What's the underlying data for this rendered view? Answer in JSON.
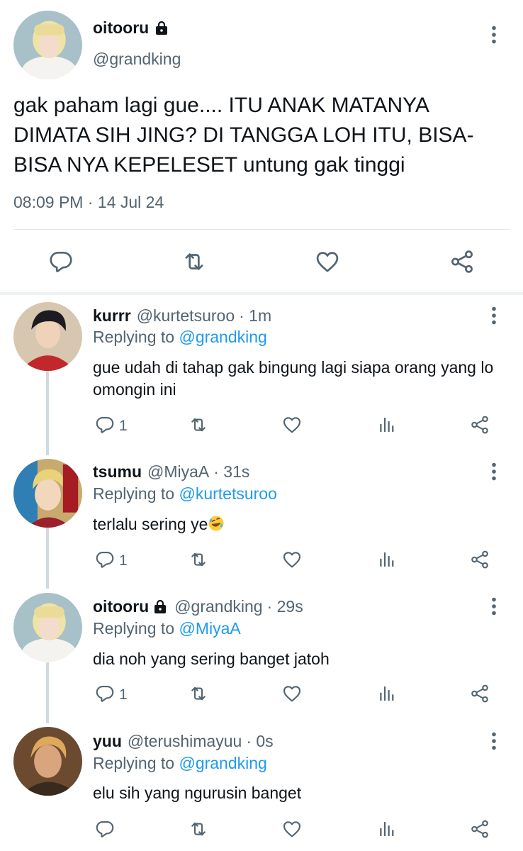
{
  "main_tweet": {
    "display_name": "oitooru",
    "handle": "@grandking",
    "text": "gak paham lagi gue.... ITU ANAK MATANYA DIMATA SIH JING? DI TANGGA LOH ITU, BISA-BISA NYA KEPELESET untung gak tinggi",
    "time": "08:09 PM",
    "separator": "·",
    "date": "14 Jul 24",
    "icons": {
      "reply": "reply-icon",
      "retweet": "retweet-icon",
      "like": "heart-icon",
      "share": "share-icon",
      "more": "more-icon",
      "lock": "lock-icon"
    }
  },
  "replies": [
    {
      "display_name": "kurrr",
      "handle": "@kurtetsuroo",
      "time": "· 1m",
      "replying_label": "Replying to",
      "replying_to": "@grandking",
      "text": "gue udah di tahap gak bingung lagi siapa orang yang lo omongin ini",
      "reply_count": "1"
    },
    {
      "display_name": "tsumu",
      "handle": "@MiyaA",
      "time": "· 31s",
      "replying_label": "Replying to",
      "replying_to": "@kurtetsuroo",
      "text": "terlalu sering ye",
      "emoji": "rolling-on-floor-laughing",
      "reply_count": "1"
    },
    {
      "display_name": "oitooru",
      "handle": "@grandking",
      "time": "· 29s",
      "replying_label": "Replying to",
      "replying_to": "@MiyaA",
      "text": "dia noh yang sering banget jatoh",
      "reply_count": "1"
    },
    {
      "display_name": "yuu",
      "handle": "@terushimayuu",
      "time": "· 0s",
      "replying_label": "Replying to",
      "replying_to": "@grandking",
      "text": "elu sih yang ngurusin banget",
      "reply_count": ""
    }
  ],
  "colors": {
    "text": "#0f1419",
    "secondary": "#536471",
    "accent": "#1d9bf0",
    "divider": "#e1e6ea",
    "thread_line": "#cfd9de"
  }
}
